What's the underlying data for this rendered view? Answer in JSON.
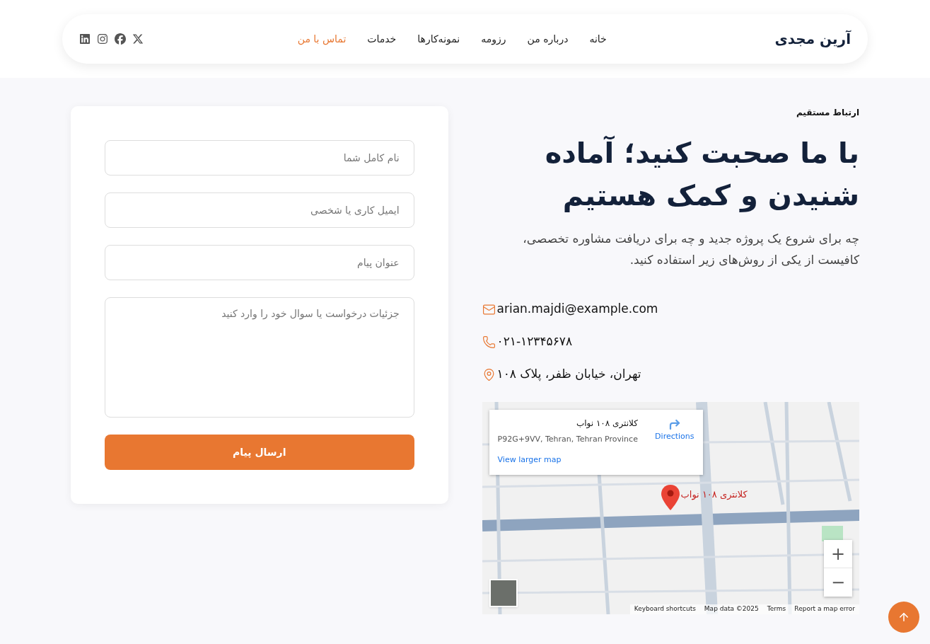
{
  "header": {
    "brand": "آرین مجدی",
    "nav": [
      {
        "label": "خانه",
        "selected": false
      },
      {
        "label": "درباره من",
        "selected": false
      },
      {
        "label": "رزومه",
        "selected": false
      },
      {
        "label": "نمونه‌کارها",
        "selected": false
      },
      {
        "label": "خدمات",
        "selected": false
      },
      {
        "label": "تماس با من",
        "selected": true
      }
    ],
    "social": [
      {
        "kind": "x"
      },
      {
        "kind": "facebook"
      },
      {
        "kind": "instagram"
      },
      {
        "kind": "linkedin"
      }
    ]
  },
  "intro": {
    "eyebrow": "ارتباط مستقیم",
    "title": "با ما صحبت کنید؛ آماده شنیدن و کمک هستیم",
    "text": "چه برای شروع یک پروژه جدید و چه برای دریافت مشاوره تخصصی، کافیست از یکی از روش‌های زیر استفاده کنید."
  },
  "contacts": [
    {
      "kind": "email",
      "text": "arian.majdi@example.com"
    },
    {
      "kind": "phone",
      "text": "۰۲۱-۱۲۳۴۵۶۷۸"
    },
    {
      "kind": "address",
      "text": "تهران، خیابان ظفر، پلاک ۱۰۸"
    }
  ],
  "map": {
    "place_card": {
      "title": "کلانتری ۱۰۸ نواب",
      "address": "P92G+9VV, Tehran, Tehran Province",
      "directions": "Directions",
      "larger_map": "View larger map"
    },
    "marker_label": "کلانتری ۱۰۸ نواب",
    "zoom": [
      "+",
      "−"
    ],
    "footer": {
      "shortcuts": "Keyboard shortcuts",
      "map_data": "Map data ©2025",
      "terms": "Terms",
      "report": "Report a map error"
    }
  },
  "form": {
    "fields": [
      {
        "kind": "input",
        "placeholder": "نام کامل شما"
      },
      {
        "kind": "input",
        "placeholder": "ایمیل کاری یا شخصی"
      },
      {
        "kind": "input",
        "placeholder": "عنوان پیام"
      },
      {
        "kind": "textarea",
        "placeholder": "جزئیات درخواست یا سوال خود را وارد کنید"
      }
    ],
    "submit": "ارسال پیام"
  }
}
